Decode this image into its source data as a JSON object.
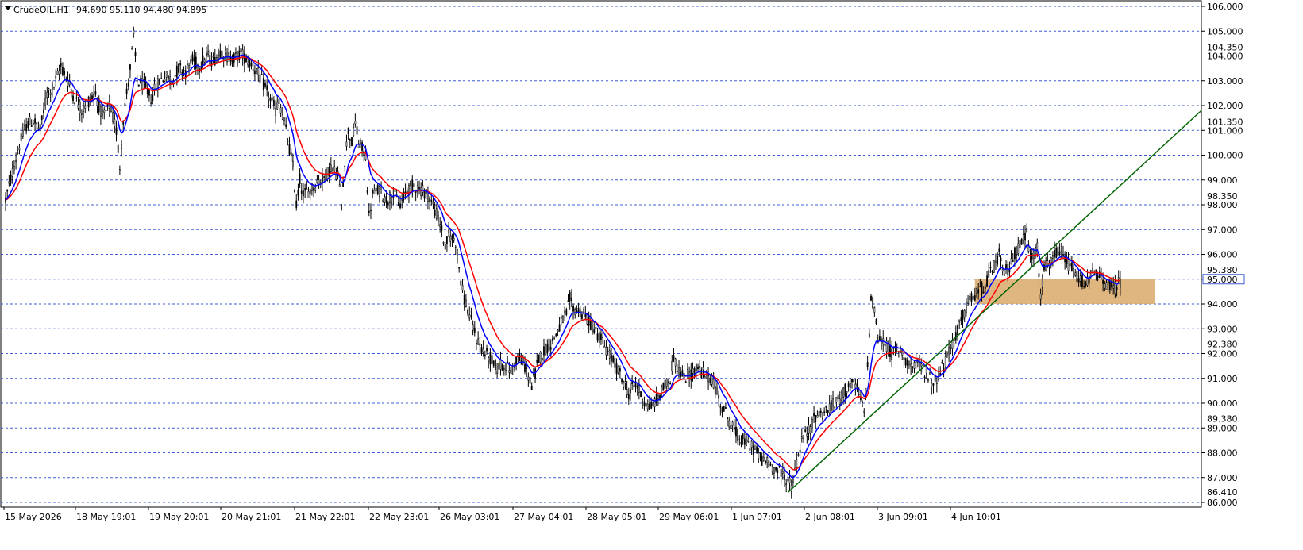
{
  "header": {
    "symbol": "CrudeOIL,H1",
    "ohlc": "94.690 95.110 94.480 94.895"
  },
  "colors": {
    "grid": "#3d5bd6",
    "bull_candle": "#000000",
    "bear_candle": "#000000",
    "ma_fast": "#0000ff",
    "ma_slow": "#ff0000",
    "trendline": "#006400",
    "zone": "#d9a86a",
    "price_tag_bg": "#ffffff",
    "price_tag_border": "#3d5bd6"
  },
  "chart_data": {
    "type": "candlestick",
    "title": "",
    "ylim": [
      86.0,
      106.0
    ],
    "y_ticks": [
      86.0,
      87.0,
      88.0,
      89.0,
      90.0,
      91.0,
      92.0,
      93.0,
      94.0,
      95.0,
      96.0,
      97.0,
      98.0,
      99.0,
      100.0,
      101.0,
      102.0,
      103.0,
      104.0,
      105.0,
      106.0
    ],
    "y_tick_labels": [
      "86.000",
      "87.000",
      "88.000",
      "89.000",
      "90.000",
      "91.000",
      "92.000",
      "93.000",
      "94.000",
      "95.000",
      "96.000",
      "97.000",
      "98.000",
      "99.000",
      "100.000",
      "101.000",
      "102.000",
      "103.000",
      "104.000",
      "105.000",
      "106.000"
    ],
    "y_extra_labels": [
      "86.410",
      "89.380",
      "92.380",
      "95.380",
      "98.350",
      "101.350",
      "104.350"
    ],
    "y_extra_values": [
      86.41,
      89.38,
      92.38,
      95.38,
      98.35,
      101.35,
      104.35
    ],
    "current_price_label": "95.000",
    "current_price": 95.0,
    "x_labels": [
      "15 May 2026",
      "18 May 19:01",
      "19 May 20:01",
      "20 May 21:01",
      "21 May 22:01",
      "22 May 23:01",
      "26 May 03:01",
      "27 May 04:01",
      "28 May 05:01",
      "29 May 06:01",
      "1 Jun 07:01",
      "2 Jun 08:01",
      "3 Jun 09:01",
      "4 Jun 10:01"
    ],
    "price_path": [
      [
        0,
        98.2
      ],
      [
        4,
        99.3
      ],
      [
        8,
        100.4
      ],
      [
        12,
        101.2
      ],
      [
        16,
        101.4
      ],
      [
        20,
        101.0
      ],
      [
        24,
        102.5
      ],
      [
        28,
        102.8
      ],
      [
        32,
        103.6
      ],
      [
        36,
        103.0
      ],
      [
        40,
        102.3
      ],
      [
        44,
        101.8
      ],
      [
        48,
        102.2
      ],
      [
        52,
        102.5
      ],
      [
        56,
        101.5
      ],
      [
        60,
        102.0
      ],
      [
        64,
        101.0
      ],
      [
        66,
        99.5
      ],
      [
        68,
        101.5
      ],
      [
        72,
        103.5
      ],
      [
        74,
        104.8
      ],
      [
        76,
        103.0
      ],
      [
        80,
        102.8
      ],
      [
        84,
        102.3
      ],
      [
        88,
        102.9
      ],
      [
        92,
        103.2
      ],
      [
        96,
        103.0
      ],
      [
        100,
        103.5
      ],
      [
        104,
        103.4
      ],
      [
        108,
        103.8
      ],
      [
        112,
        103.6
      ],
      [
        116,
        104.0
      ],
      [
        120,
        103.8
      ],
      [
        124,
        104.2
      ],
      [
        128,
        104.0
      ],
      [
        132,
        103.9
      ],
      [
        136,
        104.1
      ],
      [
        140,
        103.8
      ],
      [
        144,
        103.5
      ],
      [
        148,
        103.0
      ],
      [
        152,
        102.4
      ],
      [
        156,
        101.8
      ],
      [
        158,
        102.2
      ],
      [
        162,
        101.0
      ],
      [
        166,
        99.5
      ],
      [
        168,
        98.0
      ],
      [
        170,
        99.0
      ],
      [
        172,
        98.4
      ],
      [
        176,
        98.6
      ],
      [
        180,
        98.9
      ],
      [
        184,
        99.1
      ],
      [
        188,
        99.5
      ],
      [
        192,
        99.2
      ],
      [
        194,
        98.0
      ],
      [
        196,
        99.8
      ],
      [
        198,
        101.0
      ],
      [
        200,
        100.5
      ],
      [
        202,
        101.3
      ],
      [
        204,
        100.5
      ],
      [
        208,
        100.0
      ],
      [
        210,
        97.5
      ],
      [
        212,
        98.4
      ],
      [
        216,
        98.6
      ],
      [
        220,
        98.2
      ],
      [
        224,
        98.4
      ],
      [
        228,
        98.0
      ],
      [
        232,
        98.6
      ],
      [
        236,
        98.8
      ],
      [
        240,
        98.6
      ],
      [
        244,
        98.4
      ],
      [
        248,
        97.8
      ],
      [
        252,
        97.0
      ],
      [
        254,
        96.2
      ],
      [
        256,
        96.8
      ],
      [
        260,
        96.5
      ],
      [
        262,
        95.5
      ],
      [
        264,
        94.5
      ],
      [
        268,
        93.5
      ],
      [
        272,
        92.6
      ],
      [
        276,
        92.1
      ],
      [
        280,
        91.8
      ],
      [
        284,
        91.4
      ],
      [
        288,
        91.6
      ],
      [
        292,
        91.3
      ],
      [
        296,
        91.9
      ],
      [
        300,
        91.5
      ],
      [
        304,
        90.7
      ],
      [
        306,
        91.2
      ],
      [
        308,
        91.8
      ],
      [
        312,
        92.2
      ],
      [
        316,
        92.5
      ],
      [
        320,
        93.1
      ],
      [
        324,
        93.6
      ],
      [
        326,
        94.2
      ],
      [
        328,
        93.8
      ],
      [
        332,
        93.7
      ],
      [
        336,
        93.4
      ],
      [
        340,
        93.0
      ],
      [
        344,
        92.6
      ],
      [
        348,
        92.0
      ],
      [
        352,
        91.6
      ],
      [
        356,
        91.0
      ],
      [
        360,
        90.4
      ],
      [
        364,
        90.8
      ],
      [
        368,
        90.2
      ],
      [
        372,
        89.8
      ],
      [
        376,
        90.1
      ],
      [
        380,
        90.6
      ],
      [
        384,
        91.0
      ],
      [
        386,
        92.0
      ],
      [
        388,
        91.4
      ],
      [
        392,
        91.0
      ],
      [
        396,
        91.2
      ],
      [
        400,
        91.4
      ],
      [
        404,
        91.1
      ],
      [
        408,
        91.0
      ],
      [
        412,
        90.2
      ],
      [
        416,
        89.6
      ],
      [
        420,
        89.0
      ],
      [
        424,
        88.6
      ],
      [
        428,
        88.4
      ],
      [
        432,
        88.2
      ],
      [
        436,
        87.8
      ],
      [
        440,
        87.6
      ],
      [
        444,
        87.4
      ],
      [
        448,
        87.2
      ],
      [
        452,
        86.9
      ],
      [
        454,
        86.6
      ],
      [
        456,
        87.3
      ],
      [
        460,
        88.5
      ],
      [
        464,
        88.9
      ],
      [
        468,
        89.5
      ],
      [
        472,
        89.6
      ],
      [
        476,
        89.8
      ],
      [
        480,
        90.0
      ],
      [
        484,
        90.4
      ],
      [
        488,
        90.8
      ],
      [
        492,
        90.6
      ],
      [
        496,
        89.6
      ],
      [
        498,
        91.5
      ],
      [
        500,
        94.3
      ],
      [
        502,
        93.8
      ],
      [
        504,
        92.6
      ],
      [
        508,
        92.4
      ],
      [
        512,
        92.0
      ],
      [
        516,
        92.2
      ],
      [
        520,
        91.8
      ],
      [
        524,
        91.4
      ],
      [
        528,
        91.6
      ],
      [
        532,
        91.2
      ],
      [
        536,
        90.8
      ],
      [
        540,
        91.3
      ],
      [
        544,
        91.8
      ],
      [
        548,
        92.6
      ],
      [
        552,
        93.3
      ],
      [
        556,
        94.0
      ],
      [
        560,
        94.4
      ],
      [
        564,
        94.6
      ],
      [
        568,
        95.1
      ],
      [
        572,
        95.6
      ],
      [
        574,
        96.0
      ],
      [
        576,
        95.2
      ],
      [
        580,
        95.5
      ],
      [
        584,
        96.2
      ],
      [
        588,
        96.6
      ],
      [
        590,
        96.9
      ],
      [
        592,
        95.8
      ],
      [
        596,
        96.2
      ],
      [
        598,
        94.4
      ],
      [
        600,
        95.4
      ],
      [
        604,
        95.7
      ],
      [
        608,
        96.1
      ],
      [
        612,
        95.8
      ],
      [
        616,
        95.4
      ],
      [
        620,
        95.0
      ],
      [
        624,
        94.9
      ],
      [
        628,
        95.2
      ],
      [
        632,
        95.1
      ],
      [
        636,
        94.8
      ],
      [
        640,
        94.6
      ],
      [
        644,
        94.9
      ]
    ],
    "trendline": {
      "from": [
        452,
        86.4
      ],
      "to": [
        805,
        101.8
      ]
    },
    "zone": {
      "from_index": 560,
      "to_index": 664,
      "low": 94.0,
      "high": 95.0
    }
  }
}
